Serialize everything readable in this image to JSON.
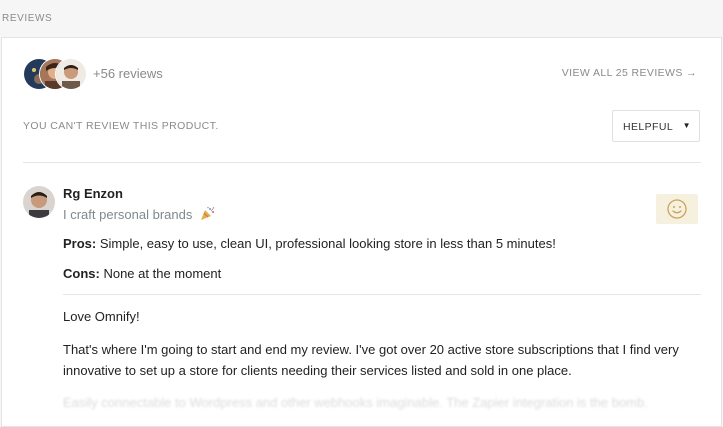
{
  "section": {
    "title": "REVIEWS"
  },
  "summary": {
    "avatars": [
      "reviewer-avatar-1",
      "reviewer-avatar-2",
      "reviewer-avatar-3"
    ],
    "more_reviews": "+56 reviews",
    "view_all": "VIEW ALL 25 REVIEWS →"
  },
  "filter": {
    "cant_review": "YOU CAN'T REVIEW THIS PRODUCT.",
    "sort_value": "HELPFUL",
    "sort_caret": "▼"
  },
  "review": {
    "author": "Rg Enzon",
    "tagline": "I craft personal brands",
    "tagline_icon": "party-popper-icon",
    "helpful_icon": "smiley-icon",
    "pros_label": "Pros:",
    "pros_text": " Simple, easy to use, clean UI, professional looking store in less than 5 minutes!",
    "cons_label": "Cons:",
    "cons_text": " None at the moment",
    "body": [
      "Love Omnify!",
      "That's where I'm going to start and end my review. I've got over 20 active store subscriptions that I find very innovative to set up a store for clients needing their services listed and sold in one place.",
      "Easily connectable to Wordpress and other webhooks imaginable. The Zapier integration is the bomb."
    ]
  },
  "colors": {
    "accent_helpful_bg": "#f6f1df",
    "smiley": "#c9a45c",
    "muted_text": "#8a8a8a",
    "tagline": "#7d8a8f"
  }
}
